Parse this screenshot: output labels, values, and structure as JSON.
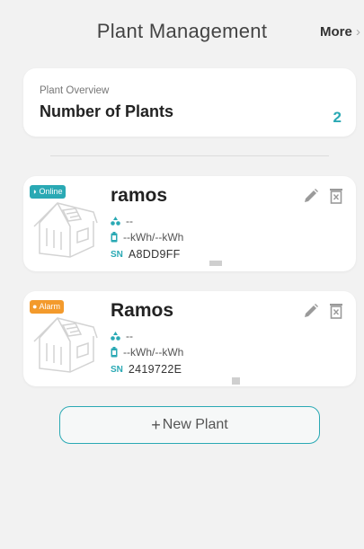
{
  "header": {
    "title": "Plant Management",
    "more_label": "More"
  },
  "overview": {
    "caption": "Plant Overview",
    "title": "Number of Plants",
    "count": "2"
  },
  "plants": [
    {
      "name": "ramos",
      "status": "Online",
      "status_color": "#2aa9b4",
      "power": "--",
      "energy": "--kWh/--kWh",
      "sn_label": "SN",
      "sn": "A8DD9FF"
    },
    {
      "name": "Ramos",
      "status": "Alarm",
      "status_color": "#f39a2c",
      "power": "--",
      "energy": "--kWh/--kWh",
      "sn_label": "SN",
      "sn": "2419722E"
    }
  ],
  "actions": {
    "new_plant_label": "New Plant"
  },
  "colors": {
    "accent": "#2aa9b4",
    "alarm": "#f39a2c",
    "background": "#f2f2f2"
  }
}
